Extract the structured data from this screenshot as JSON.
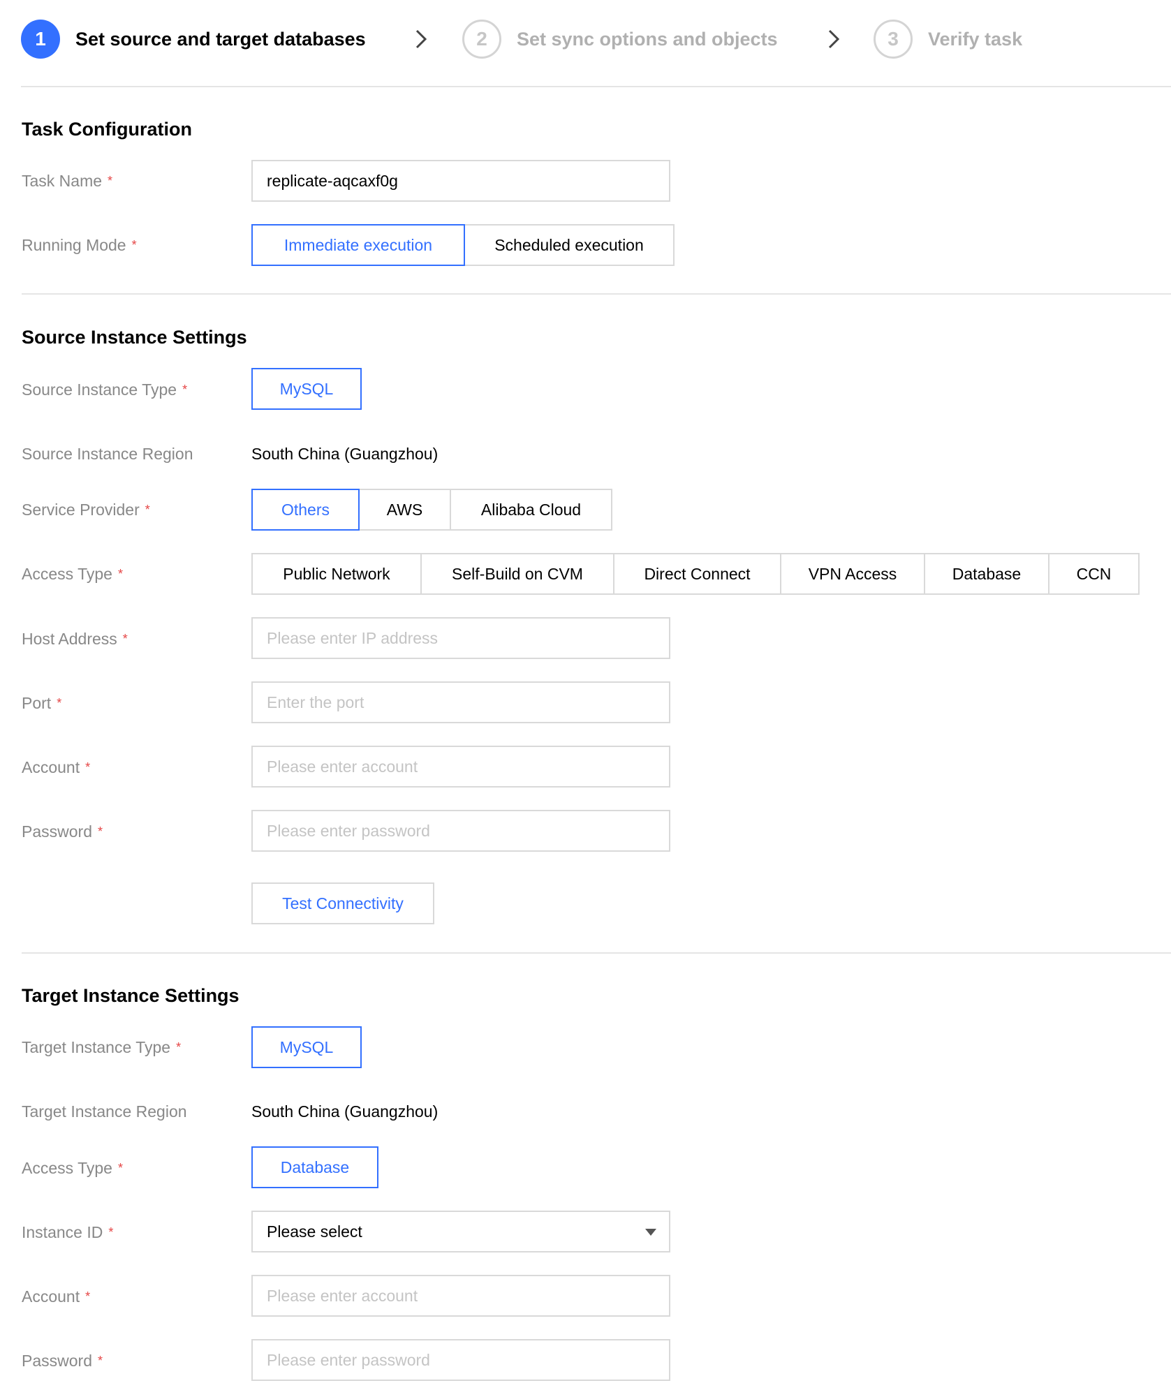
{
  "steps": [
    {
      "number": "1",
      "label": "Set source and target databases"
    },
    {
      "number": "2",
      "label": "Set sync options and objects"
    },
    {
      "number": "3",
      "label": "Verify task"
    }
  ],
  "task_config": {
    "title": "Task Configuration",
    "task_name_label": "Task Name",
    "task_name_value": "replicate-aqcaxf0g",
    "running_mode_label": "Running Mode",
    "running_mode_options": [
      "Immediate execution",
      "Scheduled execution"
    ],
    "running_mode_selected": "Immediate execution"
  },
  "source": {
    "title": "Source Instance Settings",
    "instance_type_label": "Source Instance Type",
    "instance_type_value": "MySQL",
    "region_label": "Source Instance Region",
    "region_value": "South China (Guangzhou)",
    "service_provider_label": "Service Provider",
    "service_provider_options": [
      "Others",
      "AWS",
      "Alibaba Cloud"
    ],
    "service_provider_selected": "Others",
    "access_type_label": "Access Type",
    "access_type_options": [
      "Public Network",
      "Self-Build on CVM",
      "Direct Connect",
      "VPN Access",
      "Database",
      "CCN"
    ],
    "host_label": "Host Address",
    "host_placeholder": "Please enter IP address",
    "port_label": "Port",
    "port_placeholder": "Enter the port",
    "account_label": "Account",
    "account_placeholder": "Please enter account",
    "password_label": "Password",
    "password_placeholder": "Please enter password",
    "test_button": "Test Connectivity"
  },
  "target": {
    "title": "Target Instance Settings",
    "instance_type_label": "Target Instance Type",
    "instance_type_value": "MySQL",
    "region_label": "Target Instance Region",
    "region_value": "South China (Guangzhou)",
    "access_type_label": "Access Type",
    "access_type_value": "Database",
    "instance_id_label": "Instance ID",
    "instance_id_value": "Please select",
    "account_label": "Account",
    "account_placeholder": "Please enter account",
    "password_label": "Password",
    "password_placeholder": "Please enter password"
  },
  "required_mark": "*",
  "colors": {
    "accent": "#3370ff",
    "required": "#e54545",
    "label": "#888888",
    "border": "#d9d9d9",
    "step_inactive": "#b0b0b0"
  }
}
